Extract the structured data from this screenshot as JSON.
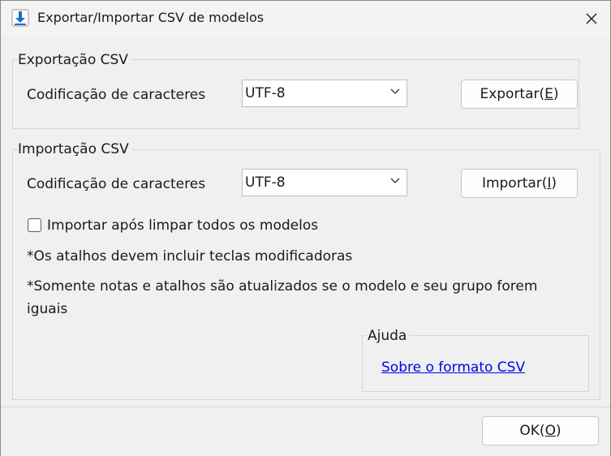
{
  "window": {
    "title": "Exportar/Importar CSV de modelos",
    "app_icon": "download-arrow-icon",
    "close_icon": "close-icon"
  },
  "export": {
    "group_title": "Exportação CSV",
    "encoding_label": "Codificação de caracteres",
    "encoding_value": "UTF-8",
    "button_label": "Exportar(",
    "button_accel": "E",
    "button_close": ")"
  },
  "import": {
    "group_title": "Importação CSV",
    "encoding_label": "Codificação de caracteres",
    "encoding_value": "UTF-8",
    "button_label": "Importar(",
    "button_accel": "I",
    "button_close": ")",
    "checkbox_label": "Importar após limpar todos os modelos",
    "checkbox_checked": false,
    "note1": "*Os atalhos devem incluir teclas modificadoras",
    "note2": "*Somente notas e atalhos são atualizados se o modelo e seu grupo forem iguais"
  },
  "help": {
    "group_title": "Ajuda",
    "link_text": "Sobre o formato CSV"
  },
  "footer": {
    "ok_label": "OK(",
    "ok_accel": "O",
    "ok_close": ")"
  },
  "colors": {
    "accent_icon": "#1a6fc9",
    "link": "#0000ee"
  }
}
